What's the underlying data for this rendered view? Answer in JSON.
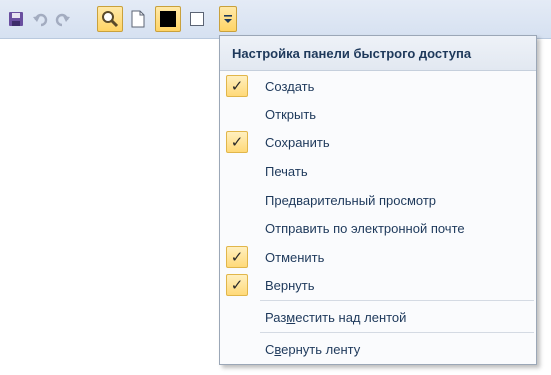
{
  "toolbar": {
    "buttons": [
      {
        "icon": "save-icon"
      },
      {
        "icon": "undo-icon"
      },
      {
        "icon": "redo-icon"
      },
      {
        "icon": "search-icon",
        "active": true
      },
      {
        "icon": "new-document-icon"
      },
      {
        "icon": "black-square-icon",
        "active": true
      },
      {
        "icon": "white-square-icon"
      },
      {
        "icon": "customize-dropdown-icon",
        "active": true
      }
    ]
  },
  "menu": {
    "title": "Настройка панели быстрого доступа",
    "items": [
      {
        "label": "Создать",
        "checked": true
      },
      {
        "label": "Открыть",
        "checked": false
      },
      {
        "label": "Сохранить",
        "checked": true
      },
      {
        "label": "Печать",
        "checked": false
      },
      {
        "label": "Предварительный просмотр",
        "checked": false
      },
      {
        "label": "Отправить по электронной почте",
        "checked": false
      },
      {
        "label": "Отменить",
        "checked": true
      },
      {
        "label": "Вернуть",
        "checked": true
      }
    ],
    "place_above": {
      "before": "Раз",
      "accel": "м",
      "after": "естить над лентой"
    },
    "collapse": {
      "before": "С",
      "accel": "в",
      "after": "ернуть ленту"
    },
    "check_glyph": "✓"
  }
}
